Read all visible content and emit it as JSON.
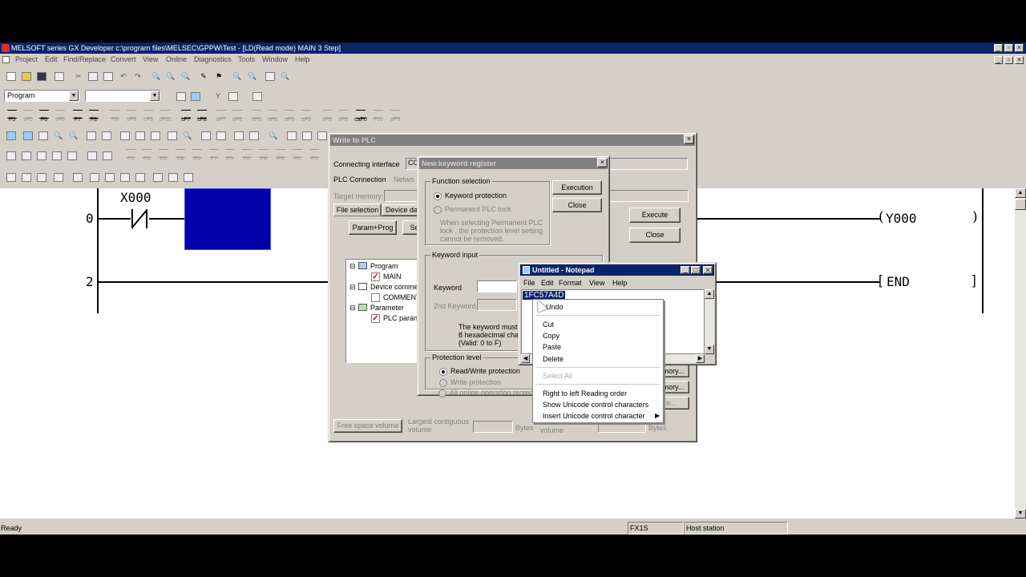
{
  "app": {
    "title": "MELSOFT series GX Developer c:\\program files\\MELSEC\\GPPW\\Test - [LD(Read mode)    MAIN    3 Step]",
    "menu": [
      "Project",
      "Edit",
      "Find/Replace",
      "Convert",
      "View",
      "Online",
      "Diagnostics",
      "Tools",
      "Window",
      "Help"
    ],
    "program_combo": "Program",
    "status": {
      "ready": "Ready",
      "cpu": "FX1S",
      "station": "Host station"
    }
  },
  "ladder": {
    "rung0_step": "0",
    "rung2_step": "2",
    "contact": "X000",
    "coil": "Y000",
    "end": "END",
    "cursor_color": "#0000a8"
  },
  "write_plc": {
    "title": "Write to PLC",
    "connecting_interface_label": "Connecting interface",
    "connecting_interface_value": "CO",
    "plc_connection_label": "PLC Connection",
    "plc_connection_value": "Netwo",
    "target_memory_label": "Target memory",
    "tabs": [
      "File selection",
      "Device da"
    ],
    "param_prog": "Param+Prog",
    "select_btn": "Se",
    "execute": "Execute",
    "close": "Close",
    "tree": {
      "program": "Program",
      "main": "MAIN",
      "device_comment": "Device comme",
      "comment": "COMMENT",
      "parameter": "Parameter",
      "plc_param": "PLC paran"
    },
    "mem_btn1": "emory...",
    "mem_btn2": "emory...",
    "mem_btn3": "e...",
    "free_space": "Free space volume",
    "largest_contiguous": "Largest contiguous volume",
    "bytes": "Bytes",
    "total_free": "volume",
    "bytes2": "Bytes"
  },
  "keyword_dialog": {
    "title": "New keyword register",
    "function_selection": "Function selection",
    "keyword_protection": "Keyword protection",
    "permanent_lock": "Permanent PLC lock",
    "permanent_note": "When selecting Permanent PLC lock , the protection level setting cannot be removed.",
    "execution": "Execution",
    "close": "Close",
    "keyword_input": "Keyword input",
    "keyword_label": "Keyword",
    "second_keyword_label": "2nd Keyword",
    "note_line1": "The keyword must",
    "note_line2": "8 hexadecimal cha",
    "note_line3": "(Valid: 0 to F)",
    "protection_level": "Protection level",
    "rw_protection": "Read/Write protection",
    "write_protection": "Write protection",
    "all_online": "All online operation protecti"
  },
  "notepad": {
    "title": "Untitled - Notepad",
    "menu": [
      "File",
      "Edit",
      "Format",
      "View",
      "Help"
    ],
    "selected_text": "1FC57A4D"
  },
  "context_menu": {
    "items": [
      "Undo",
      "Cut",
      "Copy",
      "Paste",
      "Delete",
      "Select All",
      "Right to left Reading order",
      "Show Unicode control characters",
      "Insert Unicode control character"
    ]
  }
}
